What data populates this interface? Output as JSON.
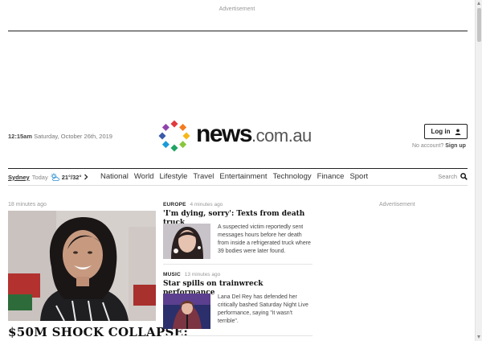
{
  "ads": {
    "top_label": "Advertisement",
    "side_label": "Advertisement"
  },
  "header": {
    "time": "12:15am",
    "date": "Saturday, October 26th, 2019",
    "logo": {
      "main": "news",
      "suffix": ".com.au"
    },
    "login_label": "Log in",
    "no_account": "No account?",
    "signup_label": "Sign up"
  },
  "weather": {
    "city": "Sydney",
    "day": "Today",
    "temps": "21°/32°"
  },
  "nav": {
    "items": [
      "National",
      "World",
      "Lifestyle",
      "Travel",
      "Entertainment",
      "Technology",
      "Finance",
      "Sport"
    ],
    "search_label": "Search"
  },
  "hero": {
    "time_ago": "18 minutes ago",
    "headline": "$50M SHOCK COLLAPSE:"
  },
  "stories": [
    {
      "category": "Europe",
      "time_ago": "4 minutes ago",
      "headline": "'I'm dying, sorry': Texts from death truck",
      "description": "A suspected victim reportedly sent messages hours before her death from inside a refrigerated truck where 39 bodies were later found."
    },
    {
      "category": "Music",
      "time_ago": "13 minutes ago",
      "headline": "Star spills on trainwreck performance",
      "description": "Lana Del Rey has defended her critically bashed Saturday Night Live performance, saying \"it wasn't terrible\"."
    }
  ],
  "colors": {
    "logo_dots": [
      "#e03a3c",
      "#f47b20",
      "#f7b718",
      "#8cc63f",
      "#1fa463",
      "#1a9bd7",
      "#3b5ba9",
      "#8e44ad"
    ]
  }
}
